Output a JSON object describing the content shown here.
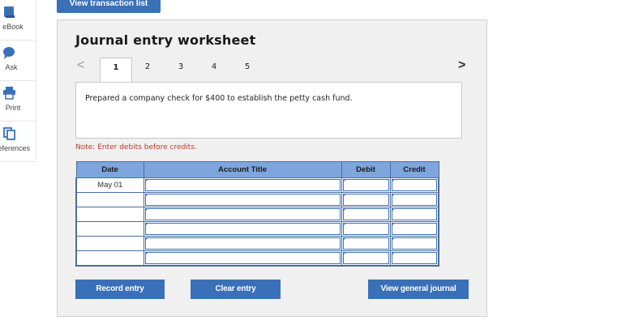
{
  "sidebar": {
    "items": [
      {
        "label": "eBook",
        "icon": "book-icon"
      },
      {
        "label": "Ask",
        "icon": "chat-bubble-icon"
      },
      {
        "label": "Print",
        "icon": "printer-icon"
      },
      {
        "label": "References",
        "icon": "copy-icon"
      }
    ]
  },
  "top_button": {
    "label": "View transaction list"
  },
  "worksheet": {
    "title": "Journal entry worksheet",
    "nav": {
      "prev": "<",
      "next": ">"
    },
    "tabs": [
      "1",
      "2",
      "3",
      "4",
      "5"
    ],
    "active_tab": "1",
    "description": "Prepared a company check for $400 to establish the petty cash fund.",
    "note": "Note: Enter debits before credits."
  },
  "table": {
    "headers": {
      "date": "Date",
      "account": "Account Title",
      "debit": "Debit",
      "credit": "Credit"
    },
    "rows": [
      {
        "date": "May 01"
      },
      {
        "date": ""
      },
      {
        "date": ""
      },
      {
        "date": ""
      },
      {
        "date": ""
      },
      {
        "date": ""
      }
    ]
  },
  "buttons": {
    "record": "Record entry",
    "clear": "Clear entry",
    "view_journal": "View general journal"
  },
  "colors": {
    "accent": "#3a70b8",
    "header_bg": "#7fa6dc",
    "note": "#c0392b"
  }
}
